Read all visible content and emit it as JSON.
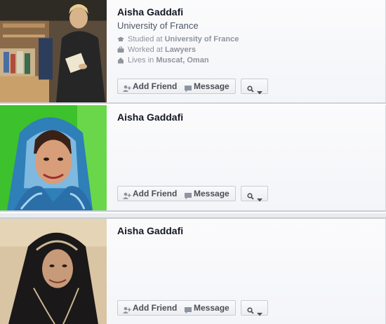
{
  "results": [
    {
      "name": "Aisha Gaddafi",
      "subtitle": "University of France",
      "details": [
        {
          "icon": "graduation-cap-icon",
          "prefix": "Studied at",
          "value": "University of France"
        },
        {
          "icon": "briefcase-icon",
          "prefix": "Worked at",
          "value": "Lawyers"
        },
        {
          "icon": "house-icon",
          "prefix": "Lives in",
          "value": "Muscat, Oman"
        }
      ],
      "photo": "woman-reading-in-library-photo"
    },
    {
      "name": "Aisha Gaddafi",
      "photo": "woman-in-blue-headscarf-photo"
    },
    {
      "name": "Aisha Gaddafi",
      "photo": "woman-in-black-headscarf-photo"
    }
  ],
  "actions": {
    "add_friend": "Add Friend",
    "message": "Message",
    "more_icon": "magnifier-dropdown-icon"
  },
  "colors": {
    "link_gray": "#90949c",
    "button_border": "#c9ccd1",
    "text": "#141823"
  }
}
